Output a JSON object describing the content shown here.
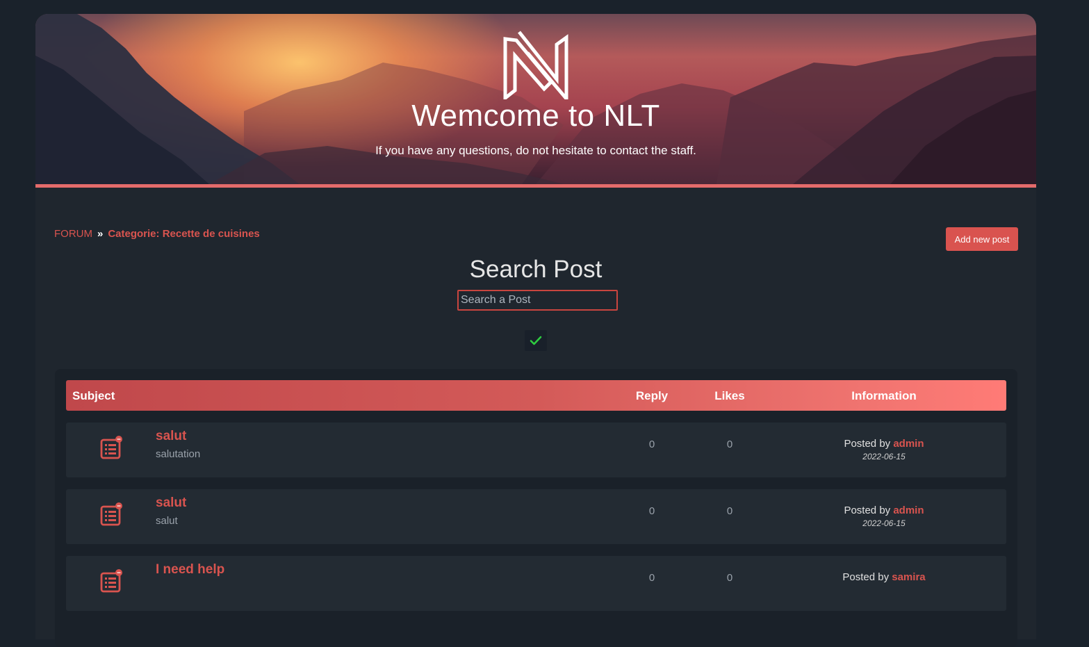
{
  "banner": {
    "title": "Wemcome to NLT",
    "subtitle": "If you have any questions, do not hesitate to contact the staff.",
    "logo_icon": "nlt-logo-icon",
    "accent_color": "#e46b6b"
  },
  "breadcrumb": {
    "root": "FORUM",
    "separator": "»",
    "current": "Categorie: Recette de cuisines"
  },
  "actions": {
    "add_post_label": "Add new post"
  },
  "search": {
    "title": "Search Post",
    "placeholder": "Search a Post",
    "submit_icon": "checkmark-icon"
  },
  "table": {
    "headers": {
      "subject": "Subject",
      "reply": "Reply",
      "likes": "Likes",
      "information": "Information"
    },
    "posted_by_label": "Posted by",
    "rows": [
      {
        "title": "salut",
        "description": "salutation",
        "replies": "0",
        "likes": "0",
        "author": "admin",
        "date": "2022-06-15"
      },
      {
        "title": "salut",
        "description": "salut",
        "replies": "0",
        "likes": "0",
        "author": "admin",
        "date": "2022-06-15"
      },
      {
        "title": "I need help",
        "description": "",
        "replies": "0",
        "likes": "0",
        "author": "samira",
        "date": ""
      }
    ]
  },
  "colors": {
    "page_bg": "#1a222b",
    "panel_bg": "#1f262e",
    "primary": "#d9534f",
    "header_gradient_end": "#ff7b76"
  }
}
